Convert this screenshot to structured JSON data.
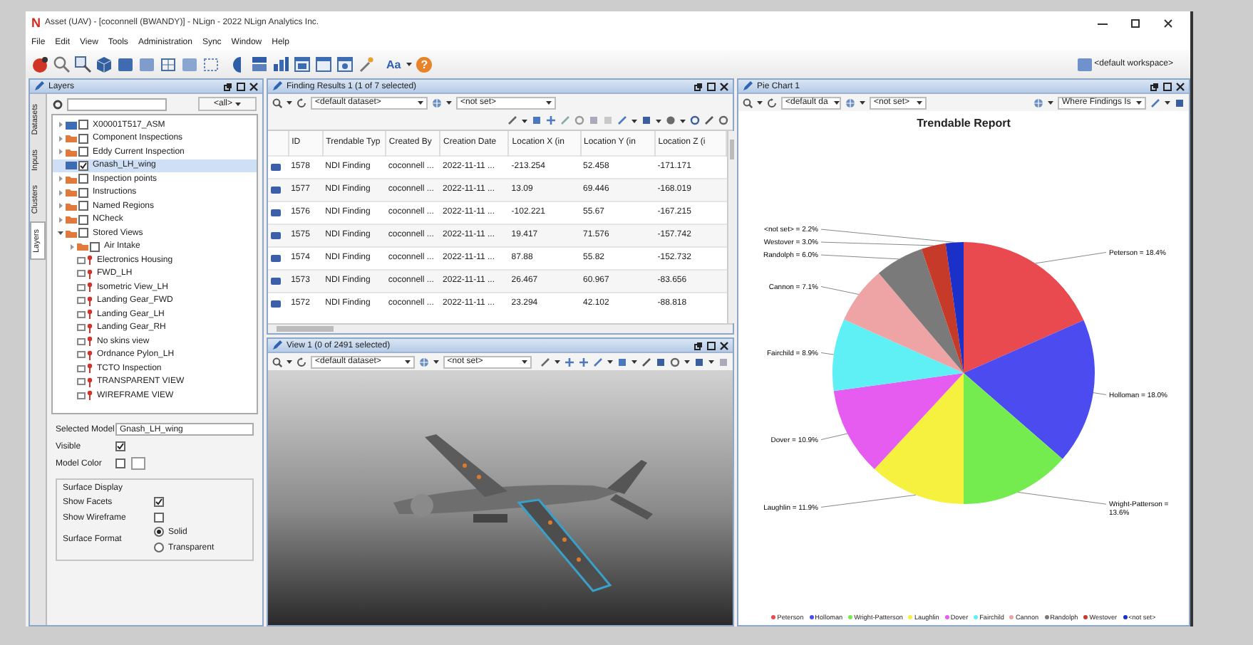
{
  "window": {
    "logo": "N",
    "title": "Asset (UAV) - [coconnell (BWANDY)] - NLign - 2022 NLign Analytics Inc."
  },
  "menu": [
    "File",
    "Edit",
    "View",
    "Tools",
    "Administration",
    "Sync",
    "Window",
    "Help"
  ],
  "toolbar": {
    "font_button": "Aa",
    "help_button": "?",
    "workspace": "<default workspace>"
  },
  "layers_panel": {
    "title": "Layers",
    "side_tabs": [
      {
        "label": "Datasets",
        "selected": false
      },
      {
        "label": "Inputs",
        "selected": false
      },
      {
        "label": "Clusters",
        "selected": false
      },
      {
        "label": "Layers",
        "selected": true
      }
    ],
    "filter": "<all>",
    "tree": [
      {
        "label": "X00001T517_ASM",
        "kind": "model",
        "checked": false,
        "expanded": false,
        "selected": false
      },
      {
        "label": "Component Inspections",
        "kind": "folder",
        "checked": false,
        "expanded": false,
        "selected": false
      },
      {
        "label": "Eddy Current Inspection",
        "kind": "folder",
        "checked": false,
        "expanded": false,
        "selected": false
      },
      {
        "label": "Gnash_LH_wing",
        "kind": "model",
        "checked": true,
        "selected": true
      },
      {
        "label": "Inspection points",
        "kind": "folder",
        "checked": false,
        "expanded": false,
        "selected": false
      },
      {
        "label": "Instructions",
        "kind": "folder",
        "checked": false,
        "expanded": false,
        "selected": false
      },
      {
        "label": "Named Regions",
        "kind": "folder",
        "checked": false,
        "expanded": false,
        "selected": false
      },
      {
        "label": "NCheck",
        "kind": "folder",
        "checked": false,
        "expanded": false,
        "selected": false
      },
      {
        "label": "Stored Views",
        "kind": "folder",
        "checked": false,
        "expanded": true,
        "selected": false,
        "children": [
          {
            "label": "Air Intake",
            "kind": "folder",
            "checked": false,
            "expanded": false,
            "selected": false
          },
          {
            "label": "Electronics Housing",
            "kind": "view",
            "selected": false
          },
          {
            "label": "FWD_LH",
            "kind": "view",
            "selected": false
          },
          {
            "label": "Isometric View_LH",
            "kind": "view",
            "selected": false
          },
          {
            "label": "Landing Gear_FWD",
            "kind": "view",
            "selected": false
          },
          {
            "label": "Landing Gear_LH",
            "kind": "view",
            "selected": false
          },
          {
            "label": "Landing Gear_RH",
            "kind": "view",
            "selected": false
          },
          {
            "label": "No skins view",
            "kind": "view",
            "selected": false
          },
          {
            "label": "Ordnance Pylon_LH",
            "kind": "view",
            "selected": false
          },
          {
            "label": "TCTO Inspection",
            "kind": "view",
            "selected": false
          },
          {
            "label": "TRANSPARENT VIEW",
            "kind": "view",
            "selected": false
          },
          {
            "label": "WIREFRAME VIEW",
            "kind": "view",
            "selected": false
          }
        ]
      }
    ],
    "properties": {
      "selected_model": {
        "label": "Selected Model",
        "value": "Gnash_LH_wing"
      },
      "visible": {
        "label": "Visible",
        "checked": true
      },
      "model_color": {
        "label": "Model Color",
        "checked": false
      },
      "surface_display": {
        "title": "Surface Display",
        "show_facets": {
          "label": "Show Facets",
          "checked": true
        },
        "show_wireframe": {
          "label": "Show Wireframe",
          "checked": false
        },
        "surface_format": {
          "label": "Surface Format",
          "options": [
            {
              "label": "Solid",
              "selected": true
            },
            {
              "label": "Transparent",
              "selected": false
            }
          ]
        }
      }
    }
  },
  "findings_panel": {
    "title": "Finding Results 1 (1 of 7 selected)",
    "dataset": "<default dataset>",
    "filter": "<not set>",
    "table": {
      "columns": [
        "ID",
        "Trendable Typ",
        "Created By",
        "Creation Date",
        "Location X (in",
        "Location Y (in",
        "Location Z (i"
      ],
      "rows": [
        [
          "1578",
          "NDI Finding",
          "coconnell ...",
          "2022-11-11 ...",
          "-213.254",
          "52.458",
          "-171.171"
        ],
        [
          "1577",
          "NDI Finding",
          "coconnell ...",
          "2022-11-11 ...",
          "13.09",
          "69.446",
          "-168.019"
        ],
        [
          "1576",
          "NDI Finding",
          "coconnell ...",
          "2022-11-11 ...",
          "-102.221",
          "55.67",
          "-167.215"
        ],
        [
          "1575",
          "NDI Finding",
          "coconnell ...",
          "2022-11-11 ...",
          "19.417",
          "71.576",
          "-157.742"
        ],
        [
          "1574",
          "NDI Finding",
          "coconnell ...",
          "2022-11-11 ...",
          "87.88",
          "55.82",
          "-152.732"
        ],
        [
          "1573",
          "NDI Finding",
          "coconnell ...",
          "2022-11-11 ...",
          "26.467",
          "60.967",
          "-83.656"
        ],
        [
          "1572",
          "NDI Finding",
          "coconnell ...",
          "2022-11-11 ...",
          "23.294",
          "42.102",
          "-88.818"
        ]
      ]
    }
  },
  "view_panel": {
    "title": "View 1 (0 of 2491 selected)",
    "dataset": "<default dataset>",
    "filter": "<not set>"
  },
  "chart_panel": {
    "title": "Pie Chart 1",
    "dataset": "<default da",
    "filter": "<not set>",
    "where": "Where Findings Is",
    "chart_data": {
      "type": "pie",
      "title": "Trendable Report",
      "categories": [
        "Peterson",
        "Holloman",
        "Wright-Patterson",
        "Laughlin",
        "Dover",
        "Fairchild",
        "Cannon",
        "Randolph",
        "Westover",
        "<not set>"
      ],
      "values": [
        18.4,
        18.0,
        13.6,
        11.9,
        10.9,
        8.9,
        7.1,
        6.0,
        3.0,
        2.2
      ],
      "colors": [
        "#e84a4f",
        "#4b4bf0",
        "#74ec50",
        "#f6f03f",
        "#e65cf0",
        "#5ff0f6",
        "#eea4a4",
        "#7a7a7a",
        "#c63a2a",
        "#1b30c8"
      ],
      "value_labels": [
        "Peterson = 18.4%",
        "Holloman = 18.0%",
        "Wright-Patterson = 13.6%",
        "Laughlin = 11.9%",
        "Dover = 10.9%",
        "Fairchild = 8.9%",
        "Cannon = 7.1%",
        "Randolph = 6.0%",
        "Westover = 3.0%",
        "<not set> = 2.2%"
      ]
    }
  }
}
